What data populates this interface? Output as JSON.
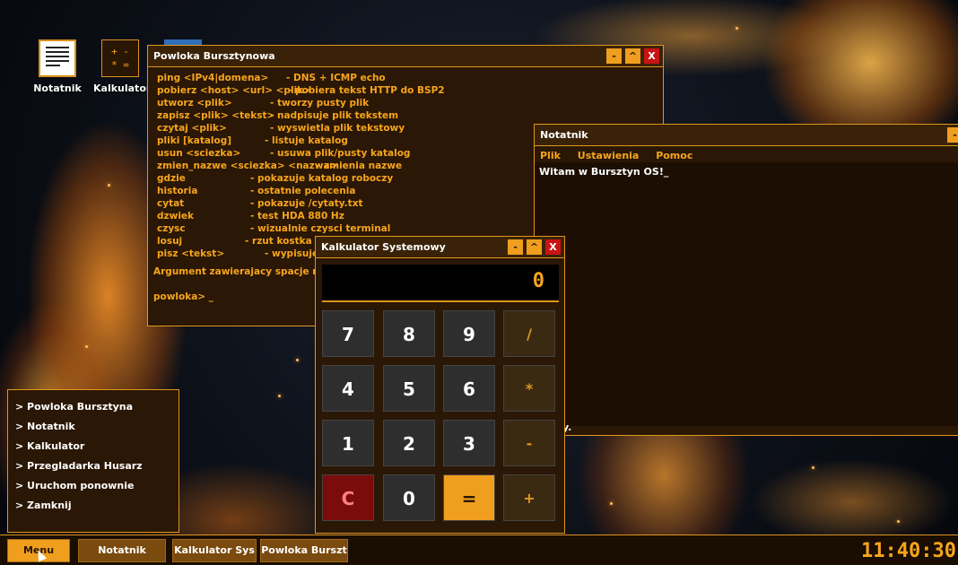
{
  "desktop": {
    "icons": [
      {
        "label": "Notatnik"
      },
      {
        "label": "Kalkulator"
      }
    ],
    "calc_icon_glyph": "+ -\n* ="
  },
  "shell": {
    "title": "Powloka Bursztynowa",
    "commands": [
      {
        "cmd": "ping <IPv4|domena>",
        "desc": "- DNS + ICMP echo"
      },
      {
        "cmd": "pobierz <host> <url> <plik>",
        "desc": "- pobiera tekst HTTP do BSP2"
      },
      {
        "cmd": "utworz <plik>",
        "desc": "- tworzy pusty plik"
      },
      {
        "cmd": "zapisz <plik> <tekst>",
        "desc": "- nadpisuje plik tekstem"
      },
      {
        "cmd": "czytaj <plik>",
        "desc": "- wyswietla plik tekstowy"
      },
      {
        "cmd": "pliki [katalog]",
        "desc": "- listuje katalog"
      },
      {
        "cmd": "usun <sciezka>",
        "desc": "- usuwa plik/pusty katalog"
      },
      {
        "cmd": "zmien_nazwe <sciezka> <nazwa>",
        "desc": "- zmienia nazwe"
      },
      {
        "cmd": "gdzie",
        "desc": "- pokazuje katalog roboczy"
      },
      {
        "cmd": "historia",
        "desc": "- ostatnie polecenia"
      },
      {
        "cmd": "cytat",
        "desc": "- pokazuje /cytaty.txt"
      },
      {
        "cmd": "dzwiek",
        "desc": "- test HDA 880 Hz"
      },
      {
        "cmd": "czysc",
        "desc": "- wizualnie czysci terminal"
      },
      {
        "cmd": "losuj",
        "desc": "- rzut kostka (nie"
      },
      {
        "cmd": "pisz <tekst>",
        "desc": "- wypisuje te"
      }
    ],
    "note": "Argument zawierajacy spacje mozn",
    "prompt": "powloka> _"
  },
  "notepad": {
    "title": "Notatnik",
    "menu": [
      "Plik",
      "Ustawienia",
      "Pomoc"
    ],
    "content": "Witam w Bursztyn OS!_",
    "tail_text": "y."
  },
  "calculator": {
    "title": "Kalkulator Systemowy",
    "display": "0",
    "buttons": [
      "7",
      "8",
      "9",
      "/",
      "4",
      "5",
      "6",
      "*",
      "1",
      "2",
      "3",
      "-",
      "C",
      "0",
      "=",
      "+"
    ]
  },
  "start_menu": {
    "items": [
      "> Powloka Bursztyna",
      "> Notatnik",
      "> Kalkulator",
      "> Przegladarka Husarz",
      "> Uruchom ponownie",
      "> Zamknij"
    ]
  },
  "taskbar": {
    "menu_label": "Menu",
    "items": [
      "Notatnik",
      "Kalkulator Sys",
      "Powloka Burszt"
    ],
    "clock": "11:40:30"
  },
  "window_controls": {
    "min": "-",
    "max": "^",
    "close": "X"
  },
  "colors": {
    "accent": "#f09e1e",
    "text_amber": "#f7a51d",
    "close": "#c91414",
    "window_bg": "#2a1705"
  }
}
